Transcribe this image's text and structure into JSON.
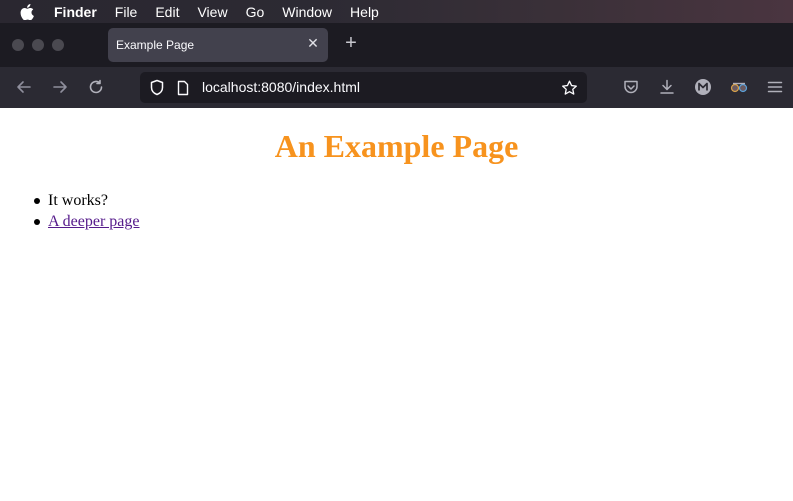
{
  "menubar": {
    "app_name": "Finder",
    "items": [
      "File",
      "Edit",
      "View",
      "Go",
      "Window",
      "Help"
    ]
  },
  "tab": {
    "title": "Example Page"
  },
  "navbar": {
    "url": "localhost:8080/index.html"
  },
  "page": {
    "title": "An Example Page",
    "title_color": "#f7931e",
    "list": [
      {
        "text": "It works?",
        "is_link": false
      },
      {
        "text": "A deeper page",
        "is_link": true
      }
    ]
  },
  "icons": {
    "back": "back-arrow-icon",
    "forward": "forward-arrow-icon",
    "reload": "reload-icon",
    "shield": "tracking-protection-icon",
    "page": "page-icon",
    "star": "bookmark-star-icon",
    "pocket": "pocket-icon",
    "download": "download-icon",
    "account": "account-icon",
    "extension": "extension-icon",
    "menu": "hamburger-menu-icon"
  }
}
